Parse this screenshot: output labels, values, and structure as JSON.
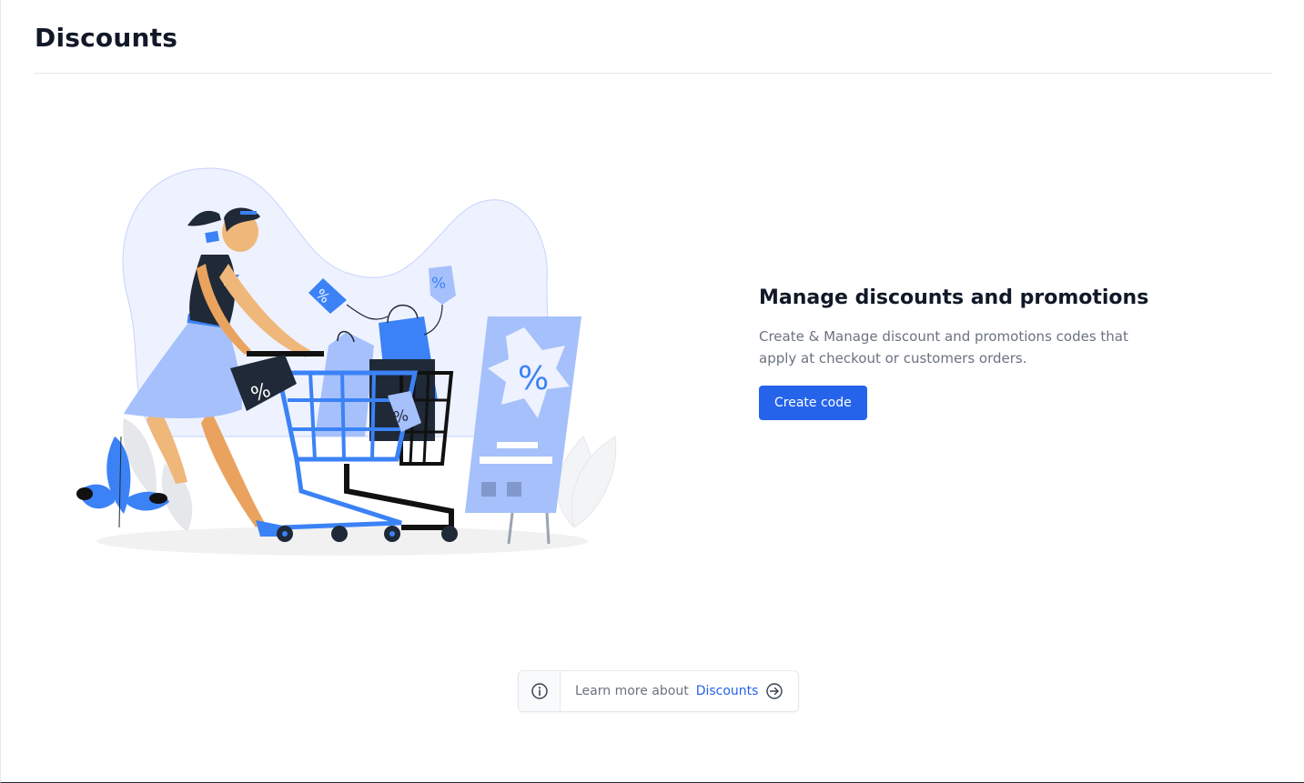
{
  "page": {
    "title": "Discounts"
  },
  "empty_state": {
    "title": "Manage discounts and promotions",
    "description": "Create & Manage discount and promotions codes that apply at checkout or customers orders.",
    "create_button_label": "Create code",
    "illustration": {
      "tag_symbol": "%"
    }
  },
  "learn_more": {
    "info_icon": "info-circle-icon",
    "prefix": "Learn more about",
    "link_label": "Discounts",
    "link_icon": "arrow-right-circle-icon"
  },
  "colors": {
    "accent": "#2563eb",
    "illustration_blue": "#3b82f6",
    "illustration_light": "#eef2ff",
    "text_muted": "#6b7280"
  }
}
